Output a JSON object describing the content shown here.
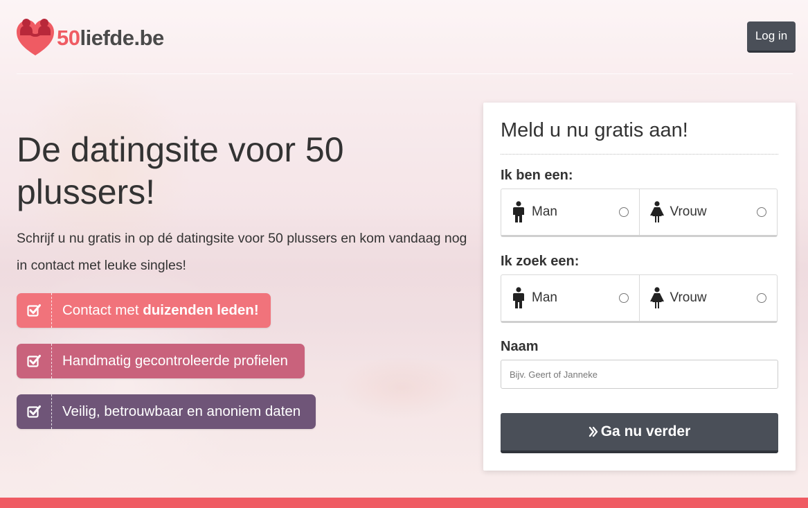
{
  "brand": {
    "logo_number": "50",
    "logo_rest": "liefde.be"
  },
  "header": {
    "login_label": "Log in"
  },
  "hero": {
    "title": "De datingsite voor 50 plussers!",
    "subtitle": "Schrijf u nu gratis in op dé datingsite voor 50 plussers en kom vandaag nog in contact met leuke singles!",
    "features": [
      {
        "text": "Contact met ",
        "bold": "duizenden leden!",
        "color": "#f1737b",
        "icon": "checkbox-icon"
      },
      {
        "text": "Handmatig gecontroleerde profielen",
        "color": "#c9627c",
        "icon": "checkbox-icon"
      },
      {
        "text": "Veilig, betrouwbaar en anoniem daten",
        "color": "#6f5578",
        "icon": "checkbox-icon"
      }
    ]
  },
  "signup": {
    "title": "Meld u nu gratis aan!",
    "iam_label": "Ik ben een:",
    "seek_label": "Ik zoek een:",
    "options": {
      "man": "Man",
      "vrouw": "Vrouw"
    },
    "name_label": "Naam",
    "name_placeholder": "Bijv. Geert of Janneke",
    "name_value": "",
    "submit_label": "Ga nu verder"
  },
  "colors": {
    "accent": "#ef5b63",
    "dark_button": "#4a4f58",
    "text": "#333333"
  }
}
